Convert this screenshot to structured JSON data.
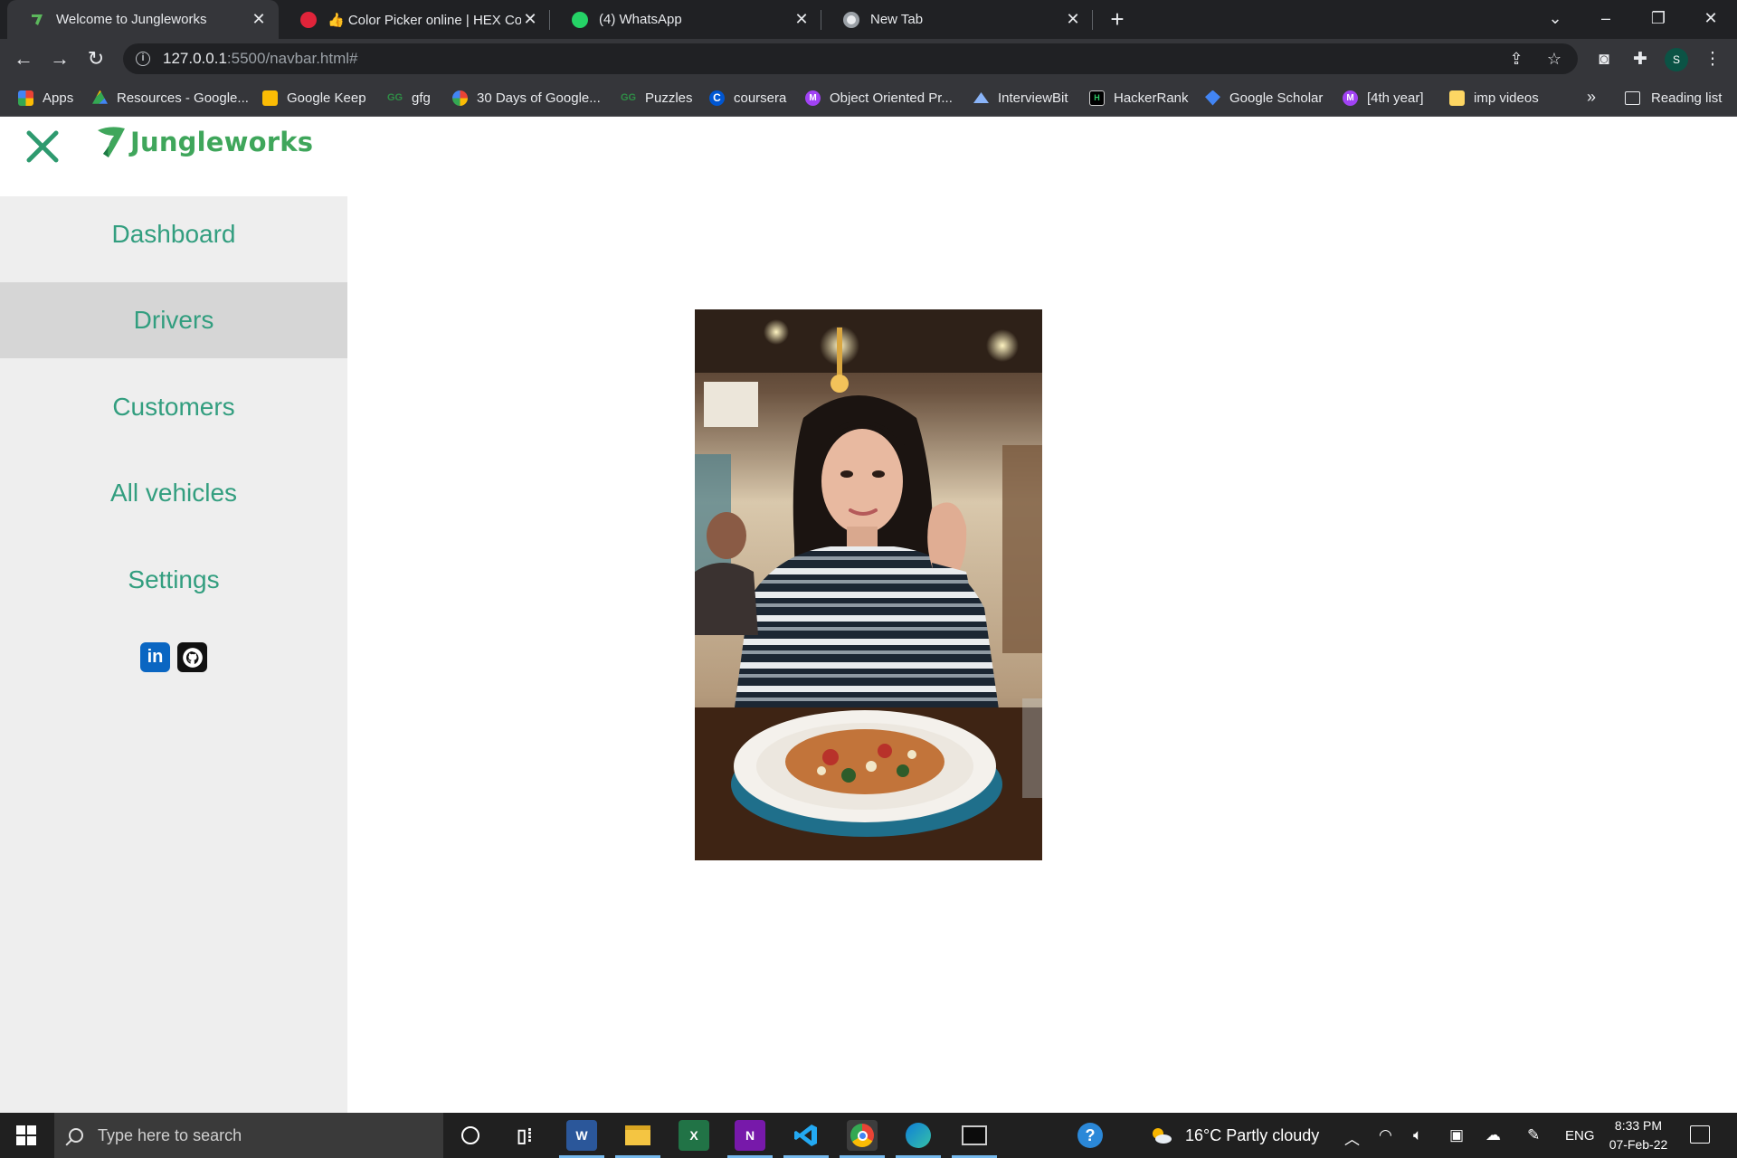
{
  "browser": {
    "tabs": [
      {
        "title": "Welcome to Jungleworks",
        "icon": "jungleworks-favicon",
        "active": true
      },
      {
        "title": "👍 Color Picker online | HEX Color",
        "icon": "color-picker-favicon",
        "active": false
      },
      {
        "title": "(4) WhatsApp",
        "icon": "whatsapp-favicon",
        "active": false
      },
      {
        "title": "New Tab",
        "icon": "chrome-favicon",
        "active": false
      }
    ],
    "url_host": "127.0.0.1",
    "url_path": ":5500/navbar.html#",
    "profile_initial": "S",
    "bookmarks": [
      {
        "label": "Apps",
        "icon": "apps-grid-icon"
      },
      {
        "label": "Resources - Google...",
        "icon": "google-drive-icon"
      },
      {
        "label": "Google Keep",
        "icon": "google-keep-icon"
      },
      {
        "label": "gfg",
        "icon": "gfg-icon"
      },
      {
        "label": "30 Days of Google...",
        "icon": "google-icon"
      },
      {
        "label": "Puzzles",
        "icon": "gfg-icon"
      },
      {
        "label": "coursera",
        "icon": "coursera-icon"
      },
      {
        "label": "Object Oriented Pr...",
        "icon": "m-badge-icon"
      },
      {
        "label": "InterviewBit",
        "icon": "interviewbit-icon"
      },
      {
        "label": "HackerRank",
        "icon": "hackerrank-icon"
      },
      {
        "label": "Google Scholar",
        "icon": "google-scholar-icon"
      },
      {
        "label": "[4th year]",
        "icon": "m-badge-icon"
      },
      {
        "label": "imp videos",
        "icon": "folder-icon"
      }
    ],
    "more_bookmarks": "»",
    "reading_list": "Reading list"
  },
  "app": {
    "brand": "Jungleworks",
    "brand_color": "#3fa65b",
    "nav_color": "#329e7f",
    "nav": [
      {
        "label": "Dashboard",
        "active": false
      },
      {
        "label": "Drivers",
        "active": true
      },
      {
        "label": "Customers",
        "active": false
      },
      {
        "label": "All vehicles",
        "active": false
      },
      {
        "label": "Settings",
        "active": false
      }
    ],
    "social": [
      {
        "name": "linkedin",
        "glyph": "in"
      },
      {
        "name": "github",
        "glyph": ""
      }
    ]
  },
  "taskbar": {
    "search_placeholder": "Type here to search",
    "weather": "16°C  Partly cloudy",
    "language": "ENG",
    "time": "8:33 PM",
    "date": "07-Feb-22",
    "apps": [
      {
        "name": "cortana"
      },
      {
        "name": "task-view"
      },
      {
        "name": "word",
        "glyph": "W"
      },
      {
        "name": "file-explorer"
      },
      {
        "name": "excel",
        "glyph": "X"
      },
      {
        "name": "onenote",
        "glyph": "N"
      },
      {
        "name": "vscode"
      },
      {
        "name": "chrome"
      },
      {
        "name": "edge"
      },
      {
        "name": "terminal"
      }
    ]
  }
}
